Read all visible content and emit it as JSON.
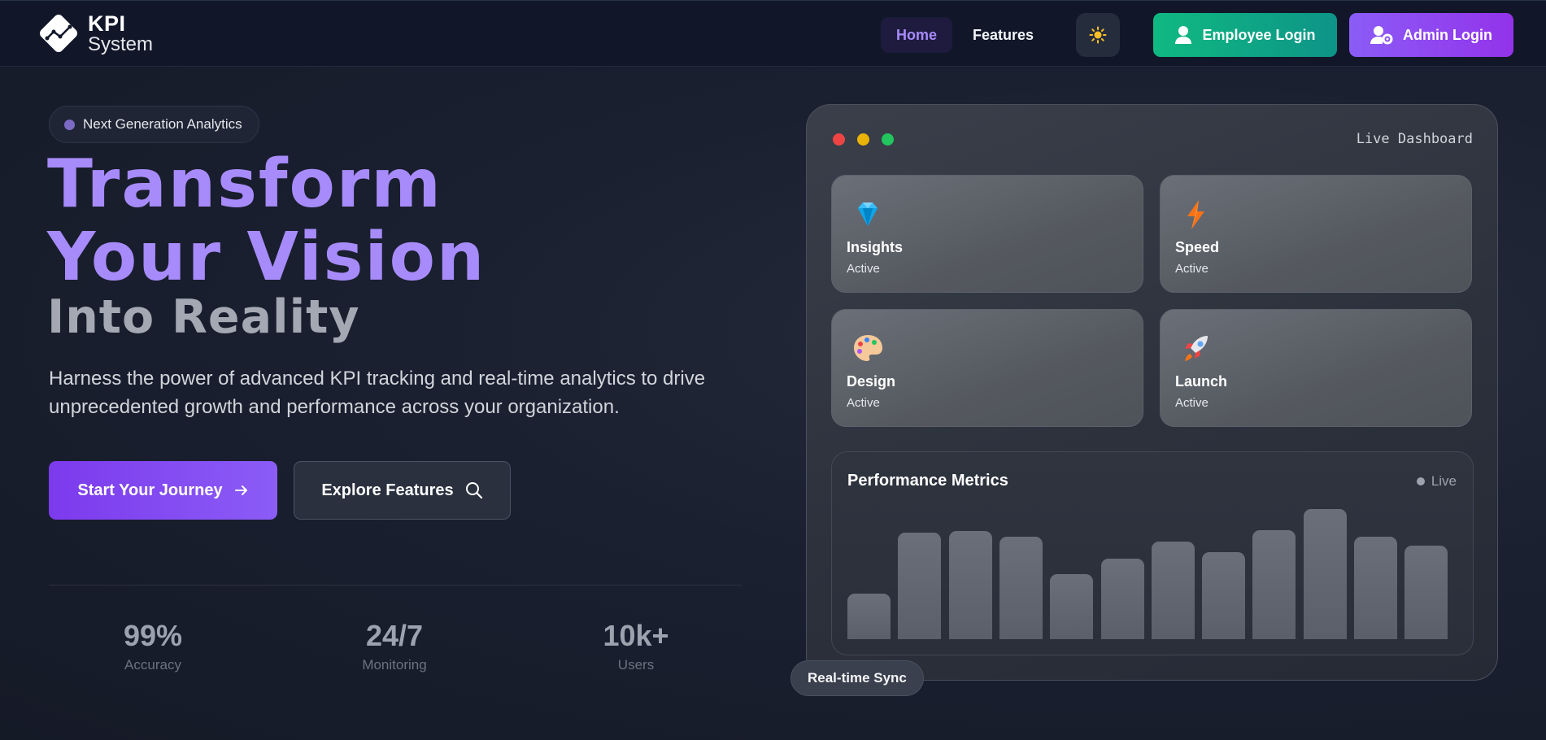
{
  "nav": {
    "logo_title": "KPI",
    "logo_subtitle": "System",
    "links": [
      {
        "label": "Home",
        "active": true
      },
      {
        "label": "Features",
        "active": false
      }
    ],
    "theme_icon": "sun-icon",
    "employee_login": "Employee Login",
    "admin_login": "Admin Login"
  },
  "hero": {
    "badge": "Next Generation Analytics",
    "headline_line1": "Transform",
    "headline_line2": "Your Vision",
    "headline_line3": "Into Reality",
    "description": "Harness the power of advanced KPI tracking and real-time analytics to drive unprecedented growth and performance across your organization.",
    "primary_cta": "Start Your Journey",
    "secondary_cta": "Explore Features",
    "stats": [
      {
        "value": "99%",
        "label": "Accuracy"
      },
      {
        "value": "24/7",
        "label": "Monitoring"
      },
      {
        "value": "10k+",
        "label": "Users"
      }
    ]
  },
  "dashboard": {
    "title": "Live Dashboard",
    "window_dot_colors": [
      "#ef4444",
      "#eab308",
      "#22c55e"
    ],
    "cards": [
      {
        "title": "Insights",
        "status": "Active",
        "icon": "gem-icon"
      },
      {
        "title": "Speed",
        "status": "Active",
        "icon": "lightning-icon"
      },
      {
        "title": "Design",
        "status": "Active",
        "icon": "palette-icon"
      },
      {
        "title": "Launch",
        "status": "Active",
        "icon": "rocket-icon"
      }
    ],
    "metrics": {
      "title": "Performance Metrics",
      "status": "Live",
      "bars": [
        0.35,
        0.82,
        0.83,
        0.79,
        0.5,
        0.62,
        0.75,
        0.67,
        0.84,
        1.0,
        0.79,
        0.72
      ]
    },
    "sync_badge": "Real-time Sync"
  },
  "colors": {
    "accent": "#a78bfa",
    "employee_button": "#10b981",
    "admin_button": "#8b5cf6"
  }
}
